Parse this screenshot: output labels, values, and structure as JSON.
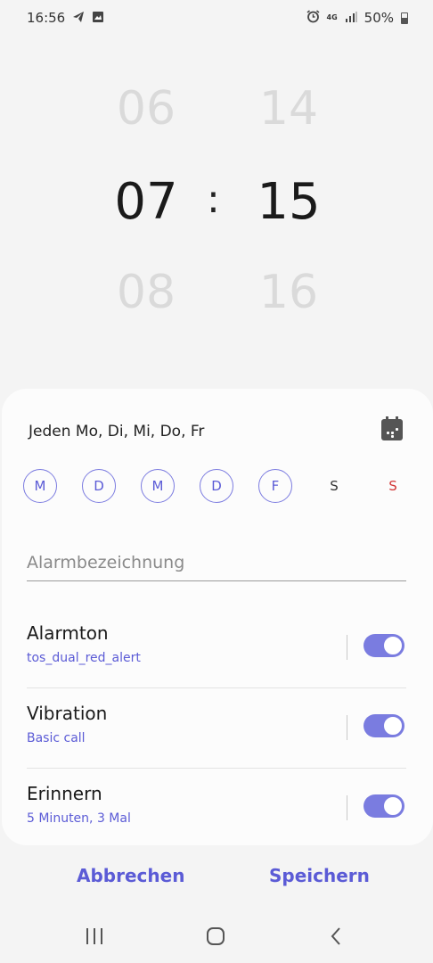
{
  "status_bar": {
    "time": "16:56",
    "network": "4G",
    "battery": "50%",
    "icons": [
      "telegram-icon",
      "gallery-icon",
      "alarm-icon",
      "signal-icon",
      "battery-icon"
    ]
  },
  "time_picker": {
    "hour_prev": "06",
    "hour": "07",
    "hour_next": "08",
    "separator": ":",
    "minute_prev": "14",
    "minute": "15",
    "minute_next": "16"
  },
  "repeat": {
    "text": "Jeden Mo, Di, Mi, Do, Fr",
    "days": [
      {
        "label": "M",
        "selected": true
      },
      {
        "label": "D",
        "selected": true
      },
      {
        "label": "M",
        "selected": true
      },
      {
        "label": "D",
        "selected": true
      },
      {
        "label": "F",
        "selected": true
      },
      {
        "label": "S",
        "selected": false
      },
      {
        "label": "S",
        "selected": false
      }
    ]
  },
  "alarm_name": {
    "placeholder": "Alarmbezeichnung"
  },
  "settings": [
    {
      "title": "Alarmton",
      "subtitle": "tos_dual_red_alert",
      "enabled": true
    },
    {
      "title": "Vibration",
      "subtitle": "Basic call",
      "enabled": true
    },
    {
      "title": "Erinnern",
      "subtitle": "5 Minuten, 3 Mal",
      "enabled": true
    }
  ],
  "actions": {
    "cancel": "Abbrechen",
    "save": "Speichern"
  },
  "colors": {
    "accent": "#5b5bd6",
    "toggle_on": "#7a7ce0",
    "sunday": "#d23636"
  }
}
